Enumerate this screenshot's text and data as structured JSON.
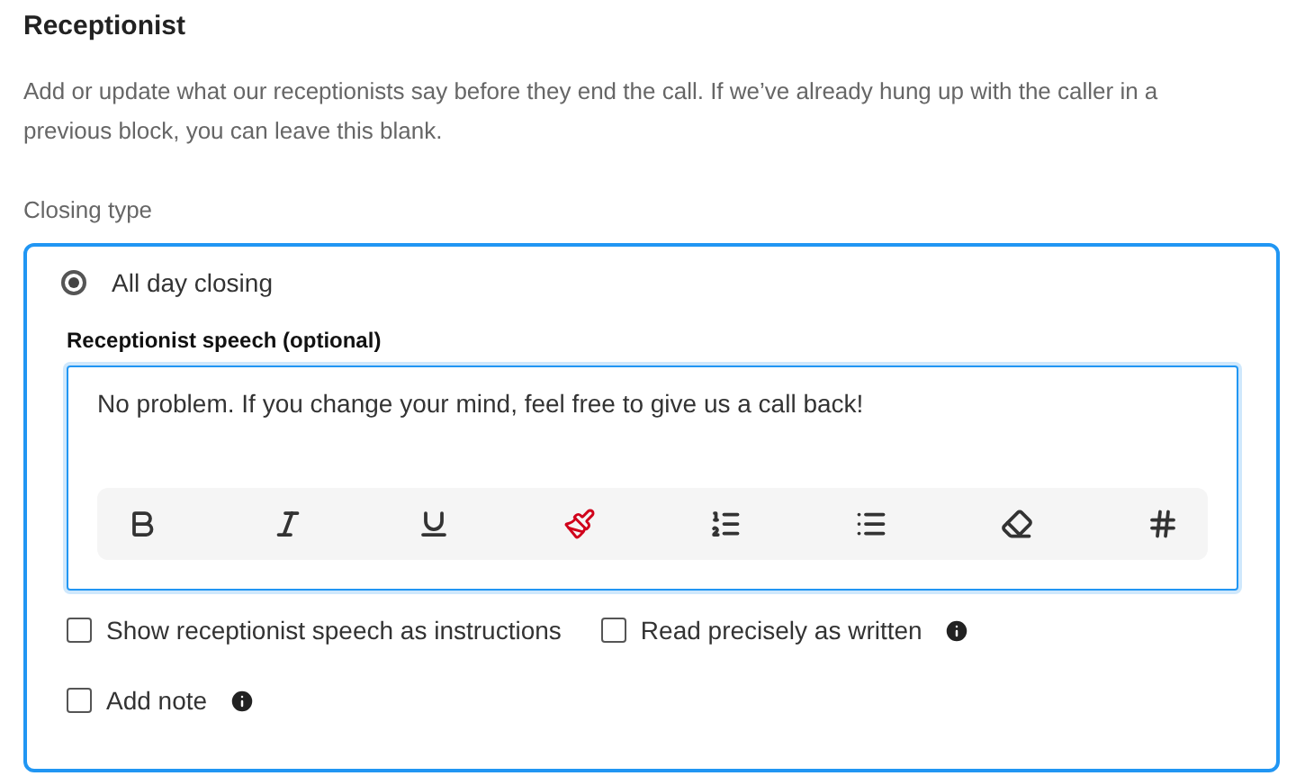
{
  "section": {
    "title": "Receptionist",
    "description": "Add or update what our receptionists say before they end the call. If we’ve already hung up with the caller in a previous block, you can leave this blank."
  },
  "closing_type": {
    "label": "Closing type",
    "options": [
      {
        "label": "All day closing",
        "selected": true
      }
    ]
  },
  "speech": {
    "label": "Receptionist speech (optional)",
    "value": "No problem. If you change your mind, feel free to give us a call back!"
  },
  "toolbar": [
    {
      "kind": "bold"
    },
    {
      "kind": "italic"
    },
    {
      "kind": "underline"
    },
    {
      "kind": "highlight"
    },
    {
      "kind": "ordered-list"
    },
    {
      "kind": "bullet-list"
    },
    {
      "kind": "eraser"
    },
    {
      "kind": "variable"
    }
  ],
  "options": [
    {
      "label": "Show receptionist speech as instructions",
      "checked": false,
      "info": false
    },
    {
      "label": "Read precisely as written",
      "checked": false,
      "info": true
    },
    {
      "label": "Add note",
      "checked": false,
      "info": true
    }
  ]
}
